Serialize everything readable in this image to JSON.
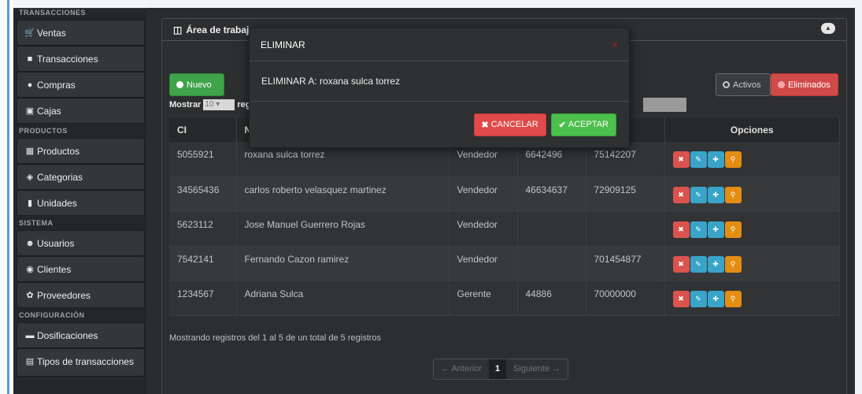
{
  "sidebar": {
    "sections": [
      {
        "title": "TRANSACCIONES",
        "items": [
          {
            "label": "Ventas",
            "icon": "cart-icon"
          },
          {
            "label": "Transacciones",
            "icon": "document-icon"
          },
          {
            "label": "Compras",
            "icon": "globe-icon"
          },
          {
            "label": "Cajas",
            "icon": "safe-icon"
          }
        ]
      },
      {
        "title": "PRODUCTOS",
        "items": [
          {
            "label": "Productos",
            "icon": "boxes-icon"
          },
          {
            "label": "Categorias",
            "icon": "tags-icon"
          },
          {
            "label": "Unidades",
            "icon": "bookmark-icon"
          }
        ]
      },
      {
        "title": "SISTEMA",
        "items": [
          {
            "label": "Usuarios",
            "icon": "user-icon"
          },
          {
            "label": "Clientes",
            "icon": "eye-icon"
          },
          {
            "label": "Proveedores",
            "icon": "leaf-icon"
          }
        ]
      },
      {
        "title": "CONFIGURACIÓN",
        "items": [
          {
            "label": "Dosificaciones",
            "icon": "folder-icon"
          },
          {
            "label": "Tipos de transacciones",
            "icon": "list-icon"
          }
        ]
      }
    ]
  },
  "panel": {
    "title": "Área de trabaj",
    "icon": "briefcase-icon",
    "collapse_icon": "chevron-up-icon"
  },
  "toolbar": {
    "nuevo_label": "Nuevo",
    "activos_label": "Activos",
    "eliminados_label": "Eliminados"
  },
  "length": {
    "prefix": "Mostrar",
    "value": "10",
    "suffix": "reg"
  },
  "table": {
    "headers": [
      "CI",
      "N",
      "",
      "",
      "",
      "Opciones"
    ],
    "rows": [
      [
        "5055921",
        "roxana sulca torrez",
        "Vendedor",
        "6642496",
        "75142207"
      ],
      [
        "34565436",
        "carlos roberto velasquez martinez",
        "Vendedor",
        "46634637",
        "72909125"
      ],
      [
        "5623112",
        "Jose Manuel Guerrero Rojas",
        "Vendedor",
        "",
        ""
      ],
      [
        "7542141",
        "Fernando Cazon ramirez",
        "Vendedor",
        "",
        "701454877"
      ],
      [
        "1234567",
        "Adriana Sulca",
        "Gerente",
        "44886",
        "70000000"
      ]
    ],
    "action_icons": [
      "remove-icon",
      "edit-icon",
      "add-icon",
      "search-icon"
    ],
    "action_colors": {
      "remove": "#d9534f",
      "edit": "#39a4c8",
      "add": "#39a4c8",
      "search": "#e38d13"
    }
  },
  "info_text": "Mostrando registros del 1 al 5 de un total de 5 registros",
  "pager": {
    "prev": "← Anterior",
    "current": "1",
    "next": "Siguiente →"
  },
  "modal": {
    "title": "ELIMINAR",
    "close_icon": "close-icon",
    "message": "ELIMINAR A: roxana sulca torrez",
    "cancel_label": "CANCELAR",
    "accept_label": "ACEPTAR"
  },
  "colors": {
    "nuevo": "#3fa34a",
    "eliminados": "#d14a4a",
    "cancel": "#e04a4a",
    "accept": "#4cbf4c",
    "accent_line": "#5a9dd8"
  }
}
